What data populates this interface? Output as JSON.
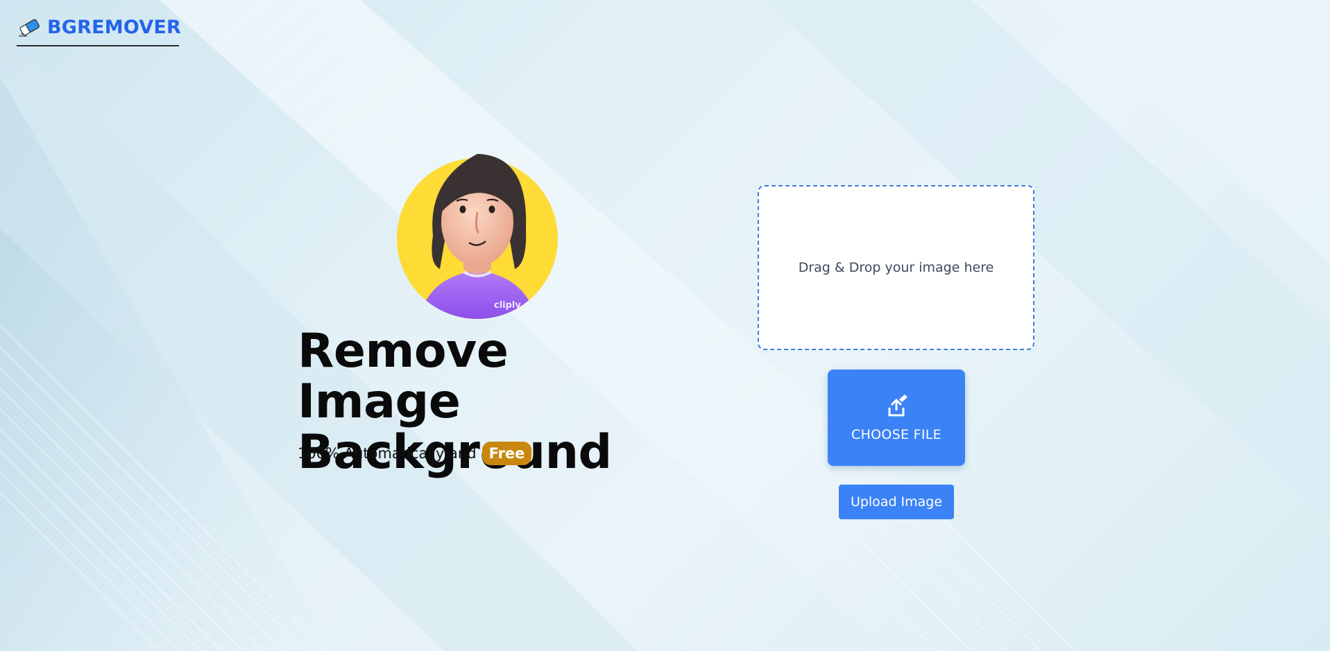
{
  "header": {
    "logo_text": "BGREMOVER",
    "logo_icon": "eraser-icon"
  },
  "hero": {
    "avatar_icon": "avatar-illustration",
    "avatar_badge_text": "cliply",
    "title_line1": "Remove Image",
    "title_line2": "Background",
    "tagline_text": "100% Automatically and",
    "free_badge": "Free"
  },
  "upload": {
    "dropzone_text": "Drag & Drop your image here",
    "choose_file_label": "CHOOSE FILE",
    "choose_file_icon": "upload-icon",
    "upload_button_label": "Upload Image"
  },
  "colors": {
    "brand_blue": "#2563eb",
    "button_blue": "#3b82f6",
    "free_badge": "#c9870f",
    "avatar_bg": "#fedb35",
    "background": "#e3f1f7"
  }
}
